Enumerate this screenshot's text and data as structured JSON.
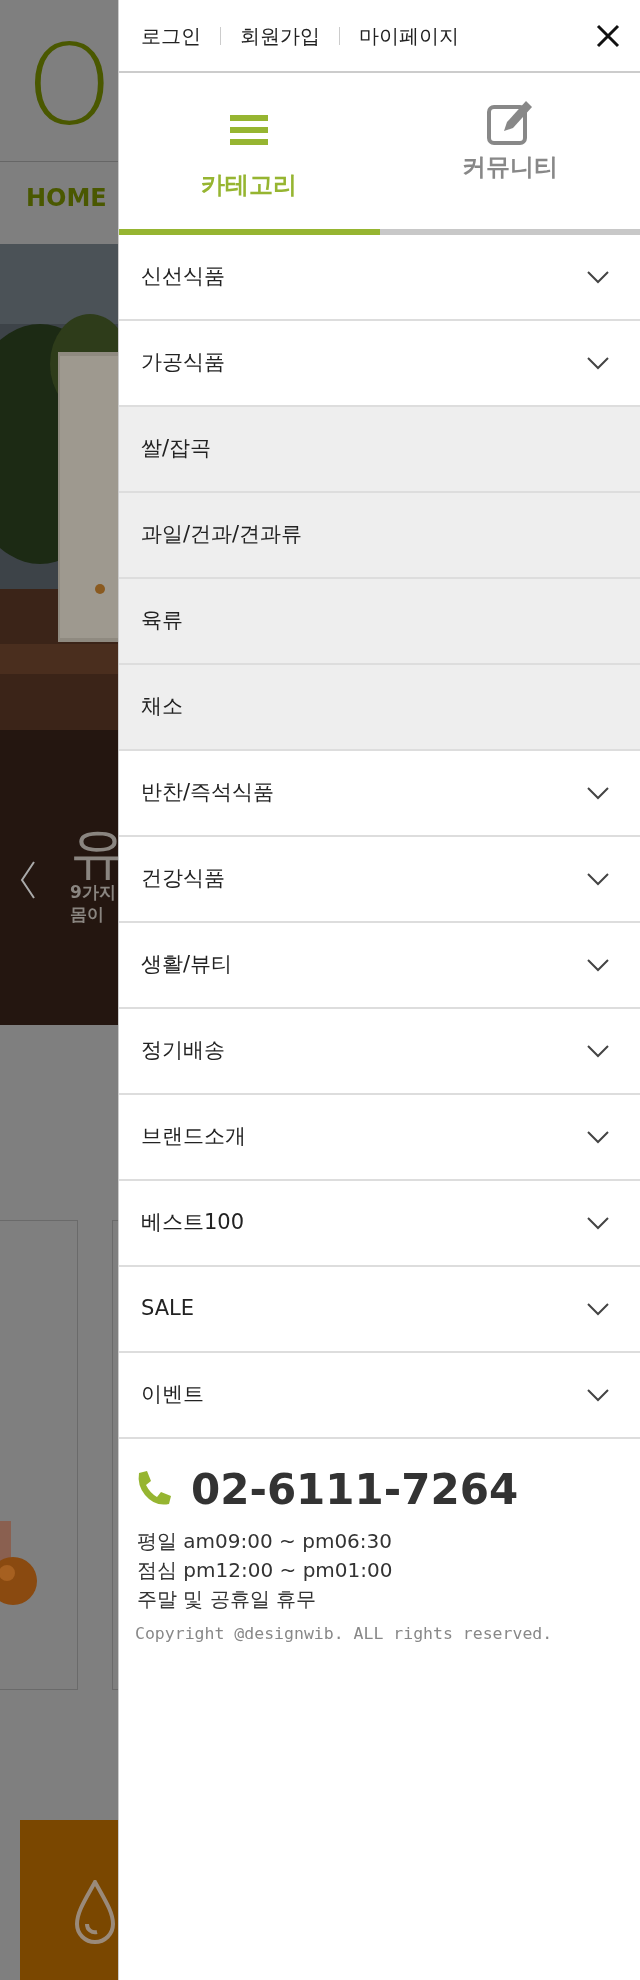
{
  "background": {
    "logo": "O",
    "nav": "HOME",
    "hero": {
      "title": "유",
      "lines": [
        "9가지",
        "몸이"
      ]
    }
  },
  "top_links": [
    {
      "label": "로그인"
    },
    {
      "label": "회원가입"
    },
    {
      "label": "마이페이지"
    }
  ],
  "tabs": [
    {
      "label": "카테고리",
      "selected": true
    },
    {
      "label": "커뮤니티",
      "selected": false
    }
  ],
  "menu": [
    {
      "label": "신선식품"
    },
    {
      "label": "가공식품",
      "children": [
        {
          "label": "쌀/잡곡"
        },
        {
          "label": "과일/건과/견과류"
        },
        {
          "label": "육류"
        },
        {
          "label": "채소"
        }
      ]
    },
    {
      "label": "반찬/즉석식품"
    },
    {
      "label": "건강식품"
    },
    {
      "label": "생활/뷰티"
    },
    {
      "label": "정기배송"
    },
    {
      "label": "브랜드소개"
    },
    {
      "label": "베스트100"
    },
    {
      "label": "SALE"
    },
    {
      "label": "이벤트"
    }
  ],
  "contact": {
    "phone": "02-6111-7264",
    "hours": [
      "평일 am09:00 ~ pm06:30",
      "점심 pm12:00 ~ pm01:00",
      "주말 및 공휴일 휴무"
    ],
    "copyright": "Copyright @designwib. ALL rights reserved."
  }
}
